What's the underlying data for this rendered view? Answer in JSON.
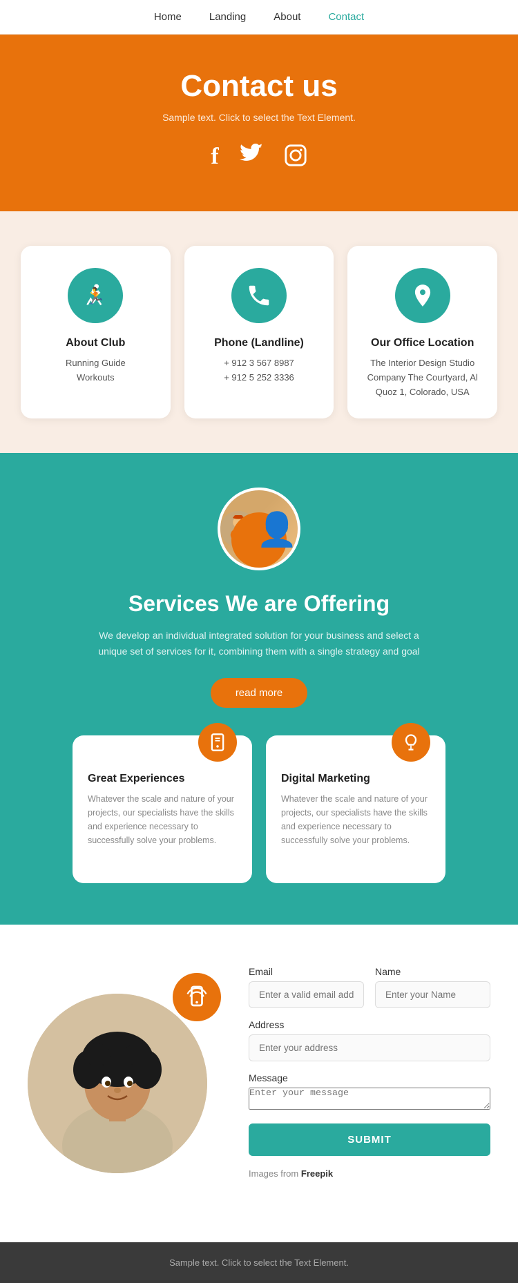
{
  "nav": {
    "items": [
      {
        "label": "Home",
        "active": false
      },
      {
        "label": "Landing",
        "active": false
      },
      {
        "label": "About",
        "active": false
      },
      {
        "label": "Contact",
        "active": true
      }
    ]
  },
  "hero": {
    "title": "Contact us",
    "subtitle": "Sample text. Click to select the Text Element.",
    "social": [
      "facebook",
      "twitter",
      "instagram"
    ]
  },
  "cards": [
    {
      "icon": "run",
      "title": "About Club",
      "lines": [
        "Running Guide",
        "Workouts"
      ]
    },
    {
      "icon": "phone",
      "title": "Phone (Landline)",
      "lines": [
        "+ 912 3 567 8987",
        "+ 912 5 252 3336"
      ]
    },
    {
      "icon": "location",
      "title": "Our Office Location",
      "lines": [
        "The Interior Design Studio Company The Courtyard, Al Quoz 1, Colorado, USA"
      ]
    }
  ],
  "services_section": {
    "title": "Services We are Offering",
    "description": "We develop an individual integrated solution for your business and select a unique set of services for it, combining them with a single strategy and goal",
    "button": "read more",
    "cards": [
      {
        "icon": "mobile",
        "title": "Great Experiences",
        "description": "Whatever the scale and nature of your projects, our specialists have the skills and experience necessary to successfully solve your problems."
      },
      {
        "icon": "bulb",
        "title": "Digital Marketing",
        "description": "Whatever the scale and nature of your projects, our specialists have the skills and experience necessary to successfully solve your problems."
      }
    ]
  },
  "contact_form": {
    "email_label": "Email",
    "email_placeholder": "Enter a valid email address",
    "name_label": "Name",
    "name_placeholder": "Enter your Name",
    "address_label": "Address",
    "address_placeholder": "Enter your address",
    "message_label": "Message",
    "message_placeholder": "Enter your message",
    "submit_label": "SUBMIT",
    "image_credit": "Images from",
    "freepik": "Freepik"
  },
  "footer": {
    "text": "Sample text. Click to select the Text Element."
  }
}
